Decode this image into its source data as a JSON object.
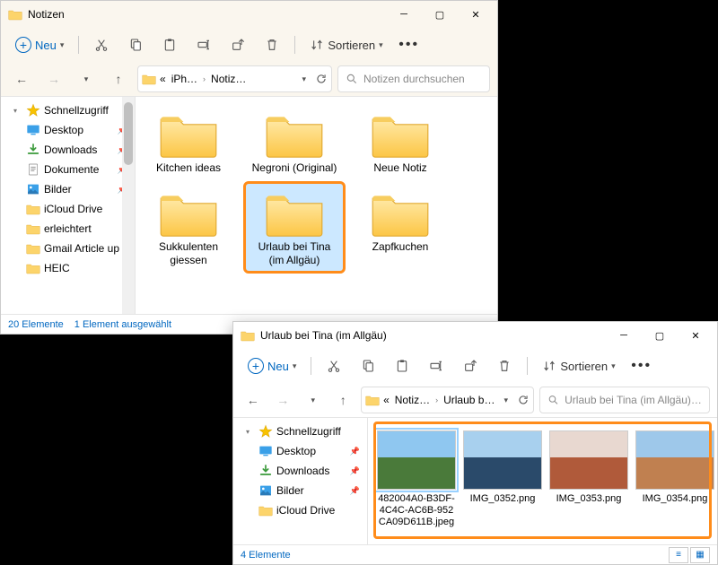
{
  "window1": {
    "title": "Notizen",
    "new_label": "Neu",
    "sort_label": "Sortieren",
    "breadcrumb": {
      "p1": "iPh…",
      "p2": "Notiz…"
    },
    "search_placeholder": "Notizen durchsuchen",
    "sidebar": [
      {
        "label": "Schnellzugriff",
        "icon": "star",
        "exp": "▾"
      },
      {
        "label": "Desktop",
        "icon": "desktop",
        "pin": true
      },
      {
        "label": "Downloads",
        "icon": "download",
        "pin": true
      },
      {
        "label": "Dokumente",
        "icon": "doc",
        "pin": true
      },
      {
        "label": "Bilder",
        "icon": "pic",
        "pin": true
      },
      {
        "label": "iCloud Drive",
        "icon": "folder"
      },
      {
        "label": "erleichtert",
        "icon": "folder"
      },
      {
        "label": "Gmail Article up",
        "icon": "folder"
      },
      {
        "label": "HEIC",
        "icon": "folder"
      }
    ],
    "folders": [
      {
        "label": "Kitchen ideas"
      },
      {
        "label": "Negroni (Original)"
      },
      {
        "label": "Neue Notiz"
      },
      {
        "label": "Sukkulenten giessen"
      },
      {
        "label": "Urlaub bei Tina (im Allgäu)",
        "selected": true,
        "highlight": true
      },
      {
        "label": "Zapfkuchen"
      }
    ],
    "status_count": "20 Elemente",
    "status_sel": "1 Element ausgewählt"
  },
  "window2": {
    "title": "Urlaub bei Tina (im Allgäu)",
    "new_label": "Neu",
    "sort_label": "Sortieren",
    "breadcrumb": {
      "p1": "Notiz…",
      "p2": "Urlaub b…"
    },
    "search_placeholder": "Urlaub bei Tina (im Allgäu) d…",
    "sidebar": [
      {
        "label": "Schnellzugriff",
        "icon": "star",
        "exp": "▾"
      },
      {
        "label": "Desktop",
        "icon": "desktop",
        "pin": true
      },
      {
        "label": "Downloads",
        "icon": "download",
        "pin": true
      },
      {
        "label": "Bilder",
        "icon": "pic",
        "pin": true
      },
      {
        "label": "iCloud Drive",
        "icon": "folder"
      }
    ],
    "files": [
      {
        "label": "482004A0-B3DF-4C4C-AC6B-952CA09D611B.jpeg",
        "c1": "#4a7a3a",
        "c2": "#8fc7f0",
        "sel": true
      },
      {
        "label": "IMG_0352.png",
        "c1": "#2a4a6a",
        "c2": "#a8d0ee"
      },
      {
        "label": "IMG_0353.png",
        "c1": "#b05a3a",
        "c2": "#e8d8d0"
      },
      {
        "label": "IMG_0354.png",
        "c1": "#c08050",
        "c2": "#9ec8ea"
      }
    ],
    "status_count": "4 Elemente"
  }
}
